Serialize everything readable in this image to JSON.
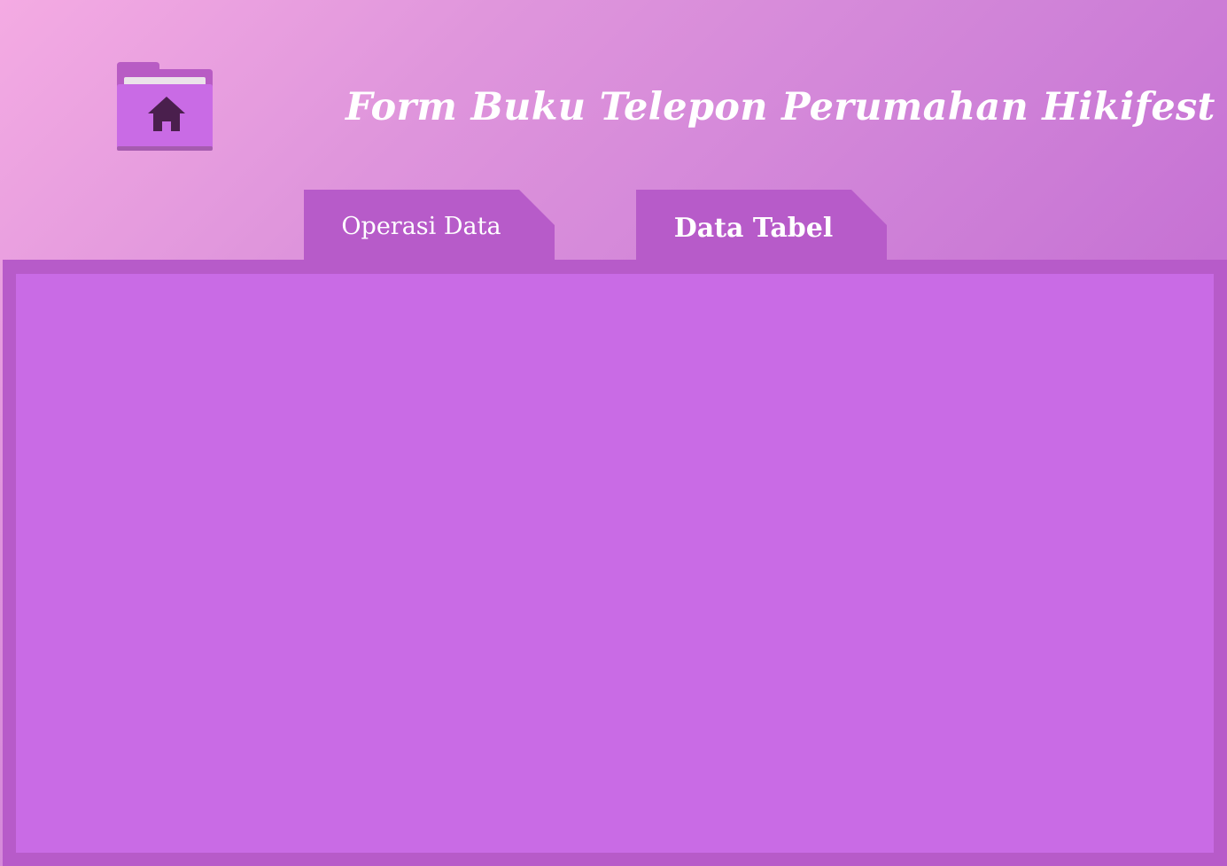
{
  "header": {
    "title": "Form Buku Telepon Perumahan Hikifest",
    "home_icon": "folder-home-icon"
  },
  "tabs": [
    {
      "label": "Operasi Data",
      "active": false
    },
    {
      "label": "Data Tabel",
      "active": true
    }
  ],
  "colors": {
    "background_start": "#f4abe3",
    "background_end": "#b555c9",
    "tab": "#b75bc9",
    "panel_border": "#b75bc9",
    "panel_fill": "#c96be5",
    "folder_body": "#c96be5",
    "folder_back": "#b85cc4",
    "house": "#4a1f4d",
    "text": "#ffffff"
  }
}
